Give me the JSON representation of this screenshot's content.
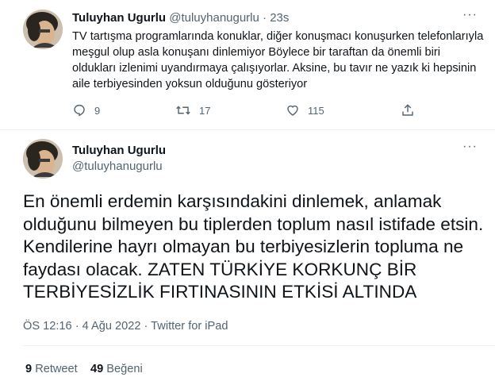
{
  "reply_tweet": {
    "author_name": "Tuluyhan Ugurlu",
    "author_handle": "@tuluyhanugurlu",
    "separator": "·",
    "time": "23s",
    "more_label": "···",
    "text": "TV tartışma programlarında konuklar, diğer konuşmacı konuşurken telefonlarıyla meşgul olup asla konuşanı dinlemiyor Böylece bir taraftan da önemli biri oldukları izlenimi uyandırmaya çalışıyorlar. Aksine, bu tavır ne yazık ki hepsinin aile terbiyesinden yoksun olduğunu gösteriyor",
    "actions": {
      "reply_count": "9",
      "retweet_count": "17",
      "like_count": "115",
      "reply_icon": "reply-icon",
      "retweet_icon": "retweet-icon",
      "like_icon": "heart-icon",
      "share_icon": "share-icon"
    }
  },
  "main_tweet": {
    "author_name": "Tuluyhan Ugurlu",
    "author_handle": "@tuluyhanugurlu",
    "more_label": "···",
    "text": "En önemli erdemin karşısındakini dinlemek, anlamak olduğunu bilmeyen bu tiplerden toplum nasıl istifade etsin. Kendilerine hayrı olmayan bu terbiyesizlerin topluma ne faydası olacak. ZATEN TÜRKİYE KORKUNÇ BİR TERBİYESİZLİK FIRTINASININ ETKİSİ ALTINDA",
    "timestamp": "ÖS 12:16 · 4 Ağu 2022 · Twitter for iPad",
    "retweets_count": "9",
    "retweets_label": "Retweet",
    "likes_count": "49",
    "likes_label": "Beğeni"
  },
  "colors": {
    "text": "#0f1419",
    "muted": "#536471",
    "border": "#eff3f4"
  }
}
